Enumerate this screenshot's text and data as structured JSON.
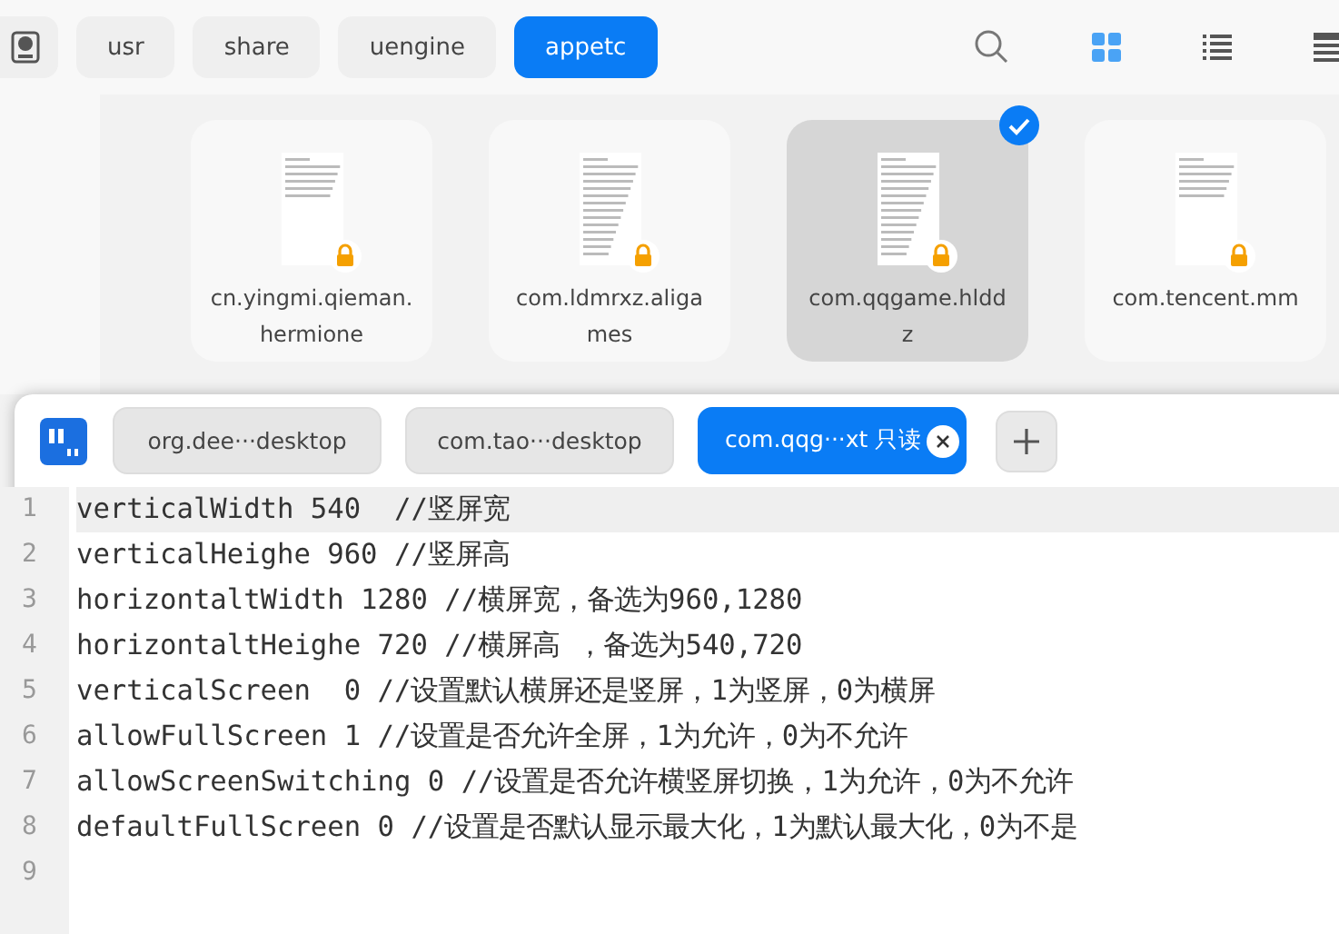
{
  "breadcrumb": [
    {
      "label": "usr",
      "selected": false
    },
    {
      "label": "share",
      "selected": false
    },
    {
      "label": "uengine",
      "selected": false
    },
    {
      "label": "appetc",
      "selected": true
    }
  ],
  "view_modes": [
    {
      "kind": "icon",
      "selected": true
    },
    {
      "kind": "list",
      "selected": false
    },
    {
      "kind": "detail",
      "selected": false
    }
  ],
  "files": [
    {
      "name": "cn.yingmi.qieman.hermione",
      "selected": false,
      "locked": true
    },
    {
      "name": "com.ldmrxz.aligames",
      "selected": false,
      "locked": true
    },
    {
      "name": "com.qqgame.hlddz",
      "selected": true,
      "locked": true
    },
    {
      "name": "com.tencent.mm",
      "selected": false,
      "locked": true
    }
  ],
  "editor": {
    "tabs": [
      {
        "label": "org.dee···desktop",
        "selected": false
      },
      {
        "label": "com.tao···desktop",
        "selected": false
      },
      {
        "label": "com.qqg···xt 只读",
        "selected": true
      }
    ],
    "lines": [
      {
        "number": "1",
        "text": "verticalWidth 540  //竖屏宽",
        "current": true
      },
      {
        "number": "2",
        "text": "verticalHeighe 960 //竖屏高",
        "current": false
      },
      {
        "number": "3",
        "text": "horizontaltWidth 1280 //横屏宽，备选为960,1280",
        "current": false
      },
      {
        "number": "4",
        "text": "horizontaltHeighe 720 //横屏高 ，备选为540,720",
        "current": false
      },
      {
        "number": "5",
        "text": "verticalScreen  0 //设置默认横屏还是竖屏，1为竖屏，0为横屏",
        "current": false
      },
      {
        "number": "6",
        "text": "allowFullScreen 1 //设置是否允许全屏，1为允许，0为不允许",
        "current": false
      },
      {
        "number": "7",
        "text": "allowScreenSwitching 0 //设置是否允许横竖屏切换，1为允许，0为不允许",
        "current": false
      },
      {
        "number": "8",
        "text": "defaultFullScreen 0 //设置是否默认显示最大化，1为默认最大化，0为不是",
        "current": false
      },
      {
        "number": "9",
        "current": false
      }
    ]
  }
}
